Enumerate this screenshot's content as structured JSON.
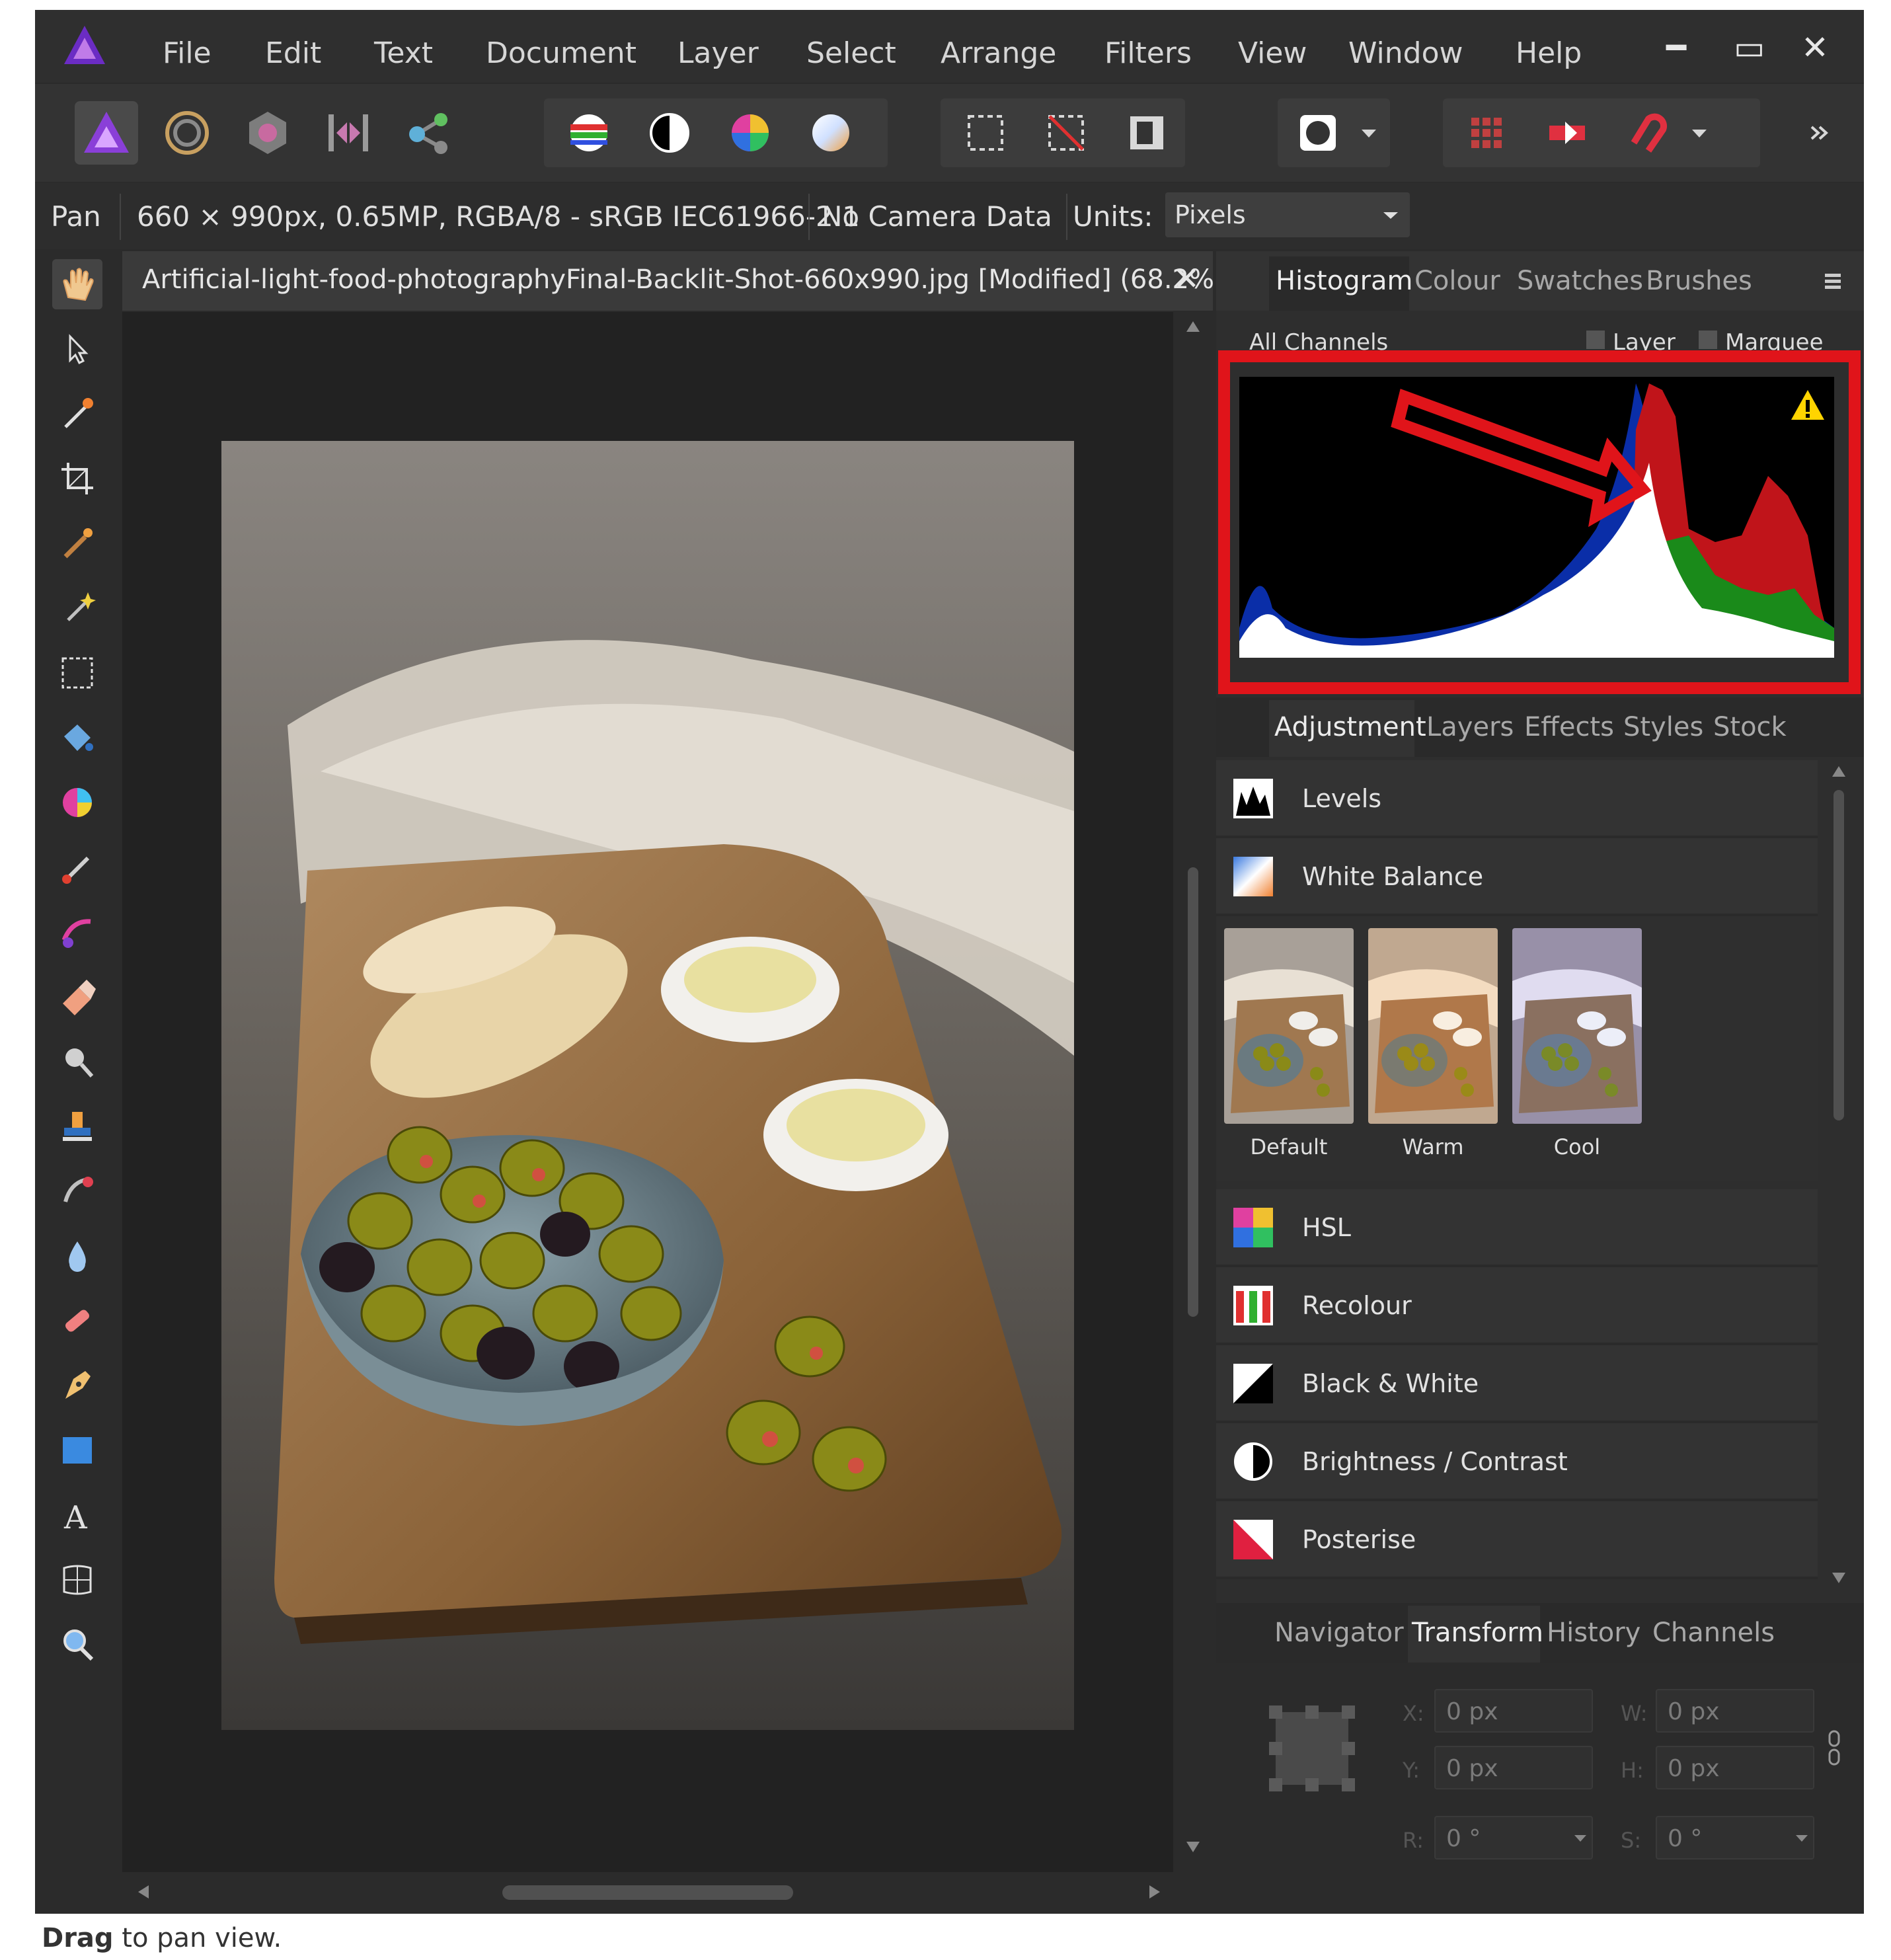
{
  "menu": {
    "items": [
      "File",
      "Edit",
      "Text",
      "Document",
      "Layer",
      "Select",
      "Arrange",
      "Filters",
      "View",
      "Window",
      "Help"
    ],
    "minimize": "━",
    "maximize": "▭",
    "close": "✕"
  },
  "context": {
    "tool": "Pan",
    "image_info": "660 × 990px, 0.65MP, RGBA/8 - sRGB IEC61966-2.1",
    "camera": "No Camera Data",
    "units_label": "Units:",
    "units_value": "Pixels"
  },
  "document": {
    "title": "Artificial-light-food-photographyFinal-Backlit-Shot-660x990.jpg [Modified] (68.2%)",
    "close": "✕"
  },
  "top_panel": {
    "tabs": [
      "Histogram",
      "Colour",
      "Swatches",
      "Brushes"
    ],
    "active": "Histogram",
    "channel_select": "All Channels",
    "layer_check": "Layer",
    "marquee_check": "Marquee"
  },
  "adjustment_panel": {
    "tabs": [
      "Adjustment",
      "Layers",
      "Effects",
      "Styles",
      "Stock"
    ],
    "active": "Adjustment",
    "items": [
      "Levels",
      "White Balance",
      "HSL",
      "Recolour",
      "Black & White",
      "Brightness / Contrast",
      "Posterise"
    ],
    "presets": [
      "Default",
      "Warm",
      "Cool"
    ]
  },
  "bottom_panel": {
    "tabs": [
      "Navigator",
      "Transform",
      "History",
      "Channels"
    ],
    "active": "Transform",
    "fields": {
      "x_label": "X:",
      "x": "0 px",
      "y_label": "Y:",
      "y": "0 px",
      "w_label": "W:",
      "w": "0 px",
      "h_label": "H:",
      "h": "0 px",
      "r_label": "R:",
      "r": "0 °",
      "s_label": "S:",
      "s": "0 °"
    }
  },
  "status": {
    "bold": "Drag",
    "rest": " to pan view."
  },
  "colors": {
    "highlight_box": "#e0141a",
    "histogram_blue": "#0a2ea8",
    "histogram_red": "#c0141a",
    "histogram_green": "#1a8a1a"
  }
}
